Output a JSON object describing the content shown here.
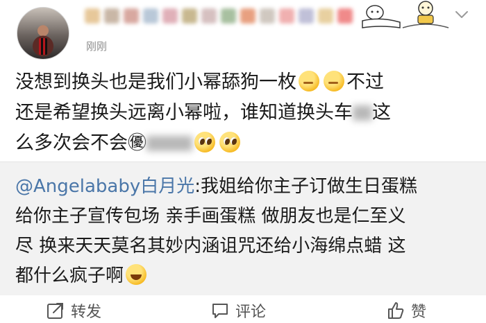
{
  "post": {
    "time": "刚刚",
    "lines": [
      "没想到换头也是我们小幂舔狗一枚",
      "不过",
      "还是希望换头远离小幂啦，谁知道换头车",
      "这",
      "么多次会不会",
      "㊝"
    ]
  },
  "quote": {
    "mention": "@Angelababy白月光",
    "lines": [
      ":我姐给你主子订做生日蛋糕",
      "给你主子宣传包场 亲手画蛋糕 做朋友也是仁至义",
      "尽 换来天天莫名其妙内涵诅咒还给小海绵点蜡 这",
      "都什么疯子啊"
    ]
  },
  "actions": {
    "repost": "转发",
    "comment": "评论",
    "like": "赞"
  },
  "icons": {
    "menu": "chevron-down-icon",
    "repost": "repost-icon",
    "comment": "comment-icon",
    "like": "thumbs-up-icon"
  },
  "colors": {
    "mention": "#4a76a8",
    "quote_bg": "#f2f2f2",
    "meta": "#8e8e8e"
  }
}
